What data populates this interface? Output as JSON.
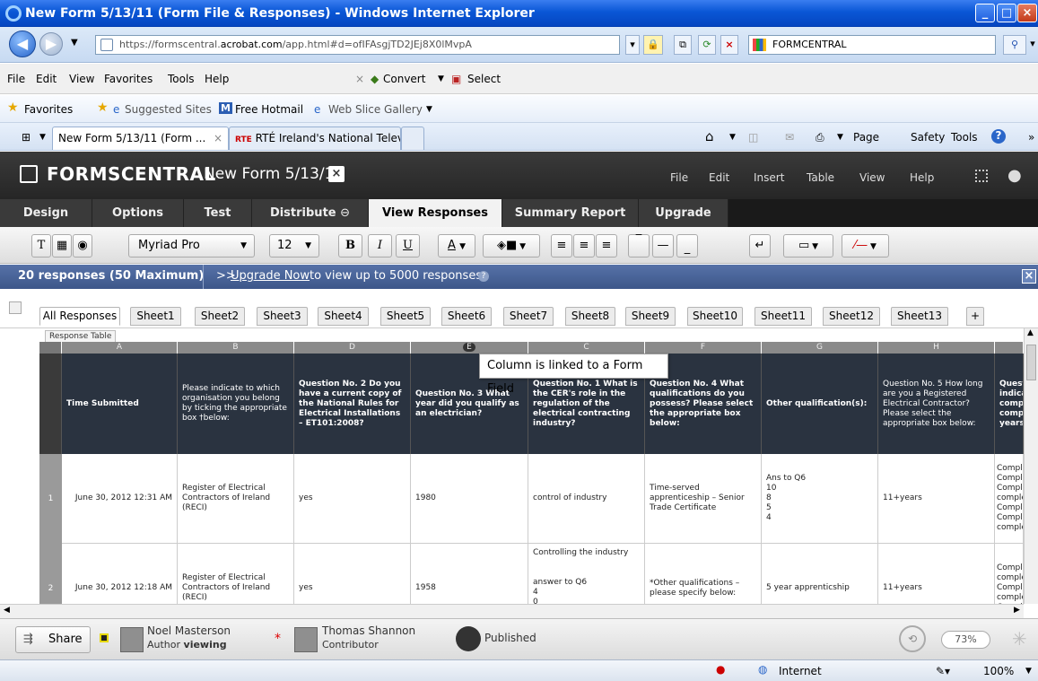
{
  "window": {
    "title": "New Form 5/13/11 (Form File & Responses) - Windows Internet Explorer"
  },
  "address": {
    "url_prefix": "https://formscentral.",
    "url_domain": "acrobat.com",
    "url_suffix": "/app.html#d=ofIFAsgjTD2JEj8X0lMvpA",
    "search_value": "FORMCENTRAL"
  },
  "menubar": {
    "items": [
      "File",
      "Edit",
      "View",
      "Favorites",
      "Tools",
      "Help"
    ],
    "convert": "Convert",
    "select": "Select"
  },
  "favorites": {
    "label": "Favorites",
    "items": [
      "Suggested Sites",
      "Free Hotmail",
      "Web Slice Gallery"
    ]
  },
  "browser_tabs": {
    "tabs": [
      "New Form 5/13/11 (Form ...",
      "RTÉ Ireland's National Televi..."
    ],
    "tab2_prefix": "RTE",
    "tools": [
      "Page",
      "Safety",
      "Tools"
    ]
  },
  "app": {
    "logo": "FORMSCENTRAL",
    "form_title": "New Form 5/13/11",
    "menu": [
      "File",
      "Edit",
      "Insert",
      "Table",
      "View",
      "Help"
    ],
    "tabs": [
      "Design",
      "Options",
      "Test",
      "Distribute",
      "View Responses",
      "Summary Report",
      "Upgrade"
    ],
    "active_tab": "View Responses"
  },
  "toolbar": {
    "font": "Myriad Pro",
    "size": "12",
    "bold": "B",
    "italic": "I",
    "underline": "U",
    "color": "A"
  },
  "banner": {
    "count": "20 responses (50 Maximum)",
    "prefix": ">>",
    "link": "Upgrade Now",
    "suffix": " to view up to 5000 responses"
  },
  "sheets": [
    "All Responses",
    "Sheet1",
    "Sheet2",
    "Sheet3",
    "Sheet4",
    "Sheet5",
    "Sheet6",
    "Sheet7",
    "Sheet8",
    "Sheet9",
    "Sheet10",
    "Sheet11",
    "Sheet12",
    "Sheet13",
    "+"
  ],
  "table": {
    "label": "Response Table",
    "col_letters": [
      "A",
      "B",
      "D",
      "E",
      "C",
      "F",
      "G",
      "H"
    ],
    "headers": [
      "Time Submitted",
      "Please indicate to which organisation you belong by ticking the appropriate box †below:",
      "Question No. 2 Do you have a current copy of the National Rules for Electrical Installations – ET101:2008?",
      "Question No. 3 What year did you qualify as an electrician?",
      "Question No. 1 What is the CER's role in the regulation of the electrical contracting industry?",
      "Question No. 4 What qualifications do you possess? Please select the appropriate box below:",
      "Other qualification(s):",
      "Question No. 5 How long are you a Registered Electrical Contractor? Please select the appropriate box below:",
      "Questi indicate comple comple years:"
    ],
    "rows": [
      {
        "num": "1",
        "cells": [
          "June 30, 2012 12:31 AM",
          "Register of Electrical Contractors of Ireland (RECI)",
          "yes",
          "1980",
          "control of industry",
          "Time-served apprenticeship – Senior Trade Certificate",
          "Ans to Q6\n10\n8\n5\n4",
          "11+years",
          "Comple\nComple\nComple\ncomple\nComple\nComple\ncomple"
        ]
      },
      {
        "num": "2",
        "cells": [
          "June 30, 2012 12:18 AM",
          "Register of Electrical Contractors of Ireland (RECI)",
          "yes",
          "1958",
          "Controlling the industry\n\n\nanswer to Q6\n4\n0",
          "*Other qualifications – please specify below:",
          "5 year apprenticship",
          "11+years",
          "Comple\ncomple\nComple\ncomple\nComple"
        ]
      }
    ]
  },
  "tooltip": "Column is linked to a Form Field",
  "footer": {
    "share": "Share",
    "user1_name": "Noel Masterson",
    "user1_role_prefix": "Author ",
    "user1_role_status": "viewing",
    "user2_name": "Thomas Shannon",
    "user2_role": "Contributor",
    "published": "Published",
    "zoom": "73%"
  },
  "statusbar": {
    "zone": "Internet",
    "zoom": "100%"
  }
}
